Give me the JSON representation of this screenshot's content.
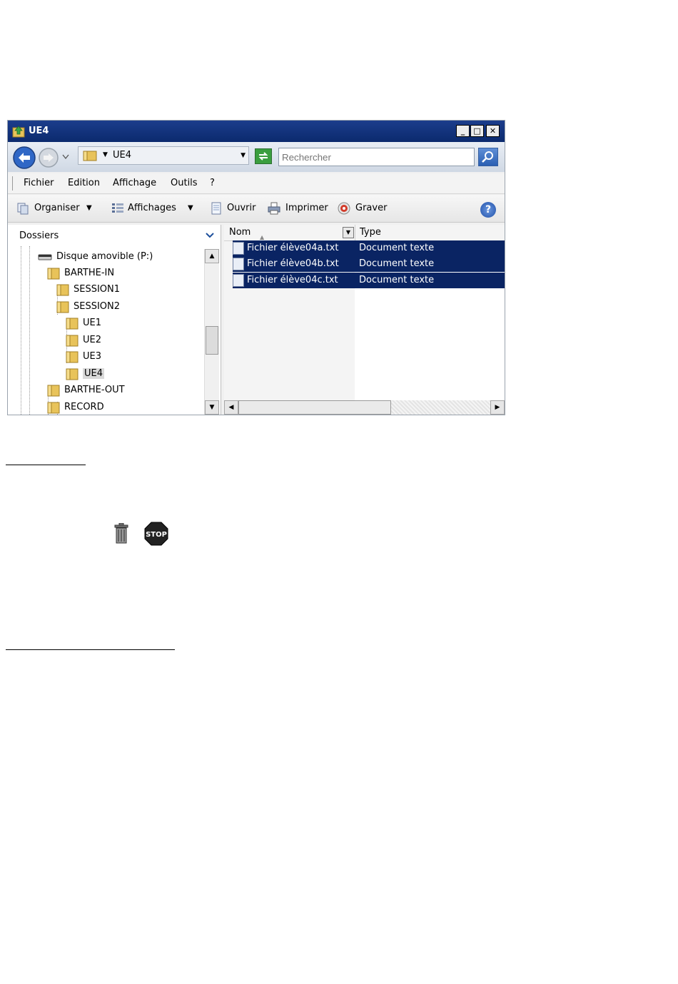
{
  "window": {
    "title": "UE4",
    "controls": {
      "minimize": "_",
      "maximize": "□",
      "close": "✕"
    }
  },
  "address": {
    "path": "UE4",
    "search_placeholder": "Rechercher"
  },
  "menu": [
    "Fichier",
    "Edition",
    "Affichage",
    "Outils",
    "?"
  ],
  "toolbar": {
    "organize": "Organiser",
    "views": "Affichages",
    "open": "Ouvrir",
    "print": "Imprimer",
    "burn": "Graver",
    "help": "?"
  },
  "folders_pane": {
    "header": "Dossiers",
    "items": [
      "Disque amovible (P:)",
      "BARTHE-IN",
      "SESSION1",
      "SESSION2",
      "UE1",
      "UE2",
      "UE3",
      "UE4",
      "BARTHE-OUT",
      "RECORD"
    ]
  },
  "file_list": {
    "columns": [
      "Nom",
      "Type"
    ],
    "rows": [
      {
        "name": "Fichier élève04a.txt",
        "type": "Document texte"
      },
      {
        "name": "Fichier élève04b.txt",
        "type": "Document texte"
      },
      {
        "name": "Fichier élève04c.txt",
        "type": "Document texte"
      }
    ]
  },
  "icons": {
    "trash": "trash-icon",
    "stop": "stop-sign-icon",
    "stop_text": "STOP"
  },
  "colors": {
    "selection": "#0a2463",
    "titlebar": "#0b2a6e"
  }
}
